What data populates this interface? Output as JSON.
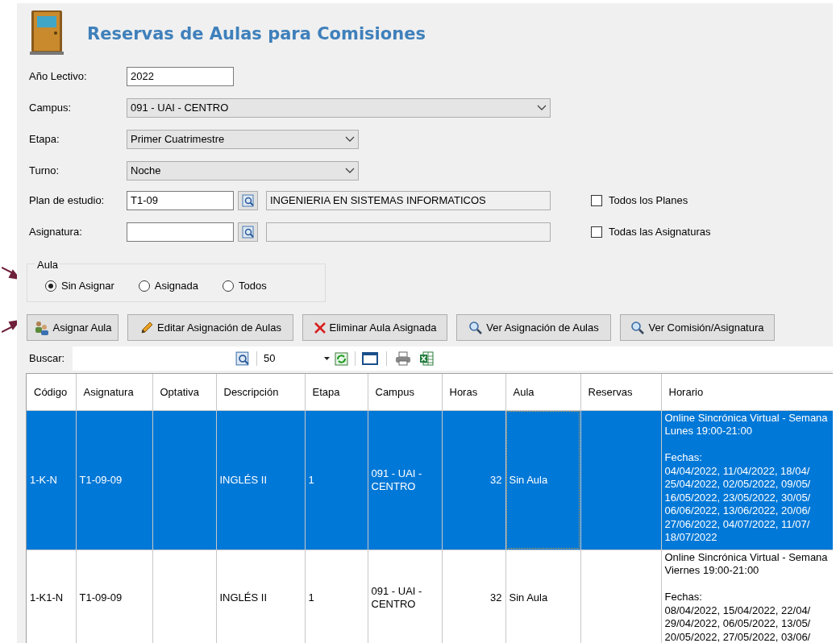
{
  "header": {
    "title": "Reservas de Aulas para Comisiones"
  },
  "form": {
    "fields": [
      {
        "kind": "text",
        "label": "Año Lectivo:",
        "value": "2022"
      },
      {
        "kind": "select",
        "label": "Campus:",
        "value": "091 - UAI - CENTRO"
      },
      {
        "kind": "select",
        "label": "Etapa:",
        "value": "Primer Cuatrimestre"
      },
      {
        "kind": "select",
        "label": "Turno:",
        "value": "Noche"
      },
      {
        "kind": "lookup",
        "label": "Plan de estudio:",
        "value": "T1-09",
        "description": "INGENIERIA EN SISTEMAS INFORMATICOS",
        "checkbox": {
          "label": "Todos los Planes",
          "checked": false
        }
      },
      {
        "kind": "lookup",
        "label": "Asignatura:",
        "checkbox": {
          "label": "Todas las Asignaturas",
          "checked": false
        }
      }
    ]
  },
  "aula_filter": {
    "title": "Aula",
    "options": [
      {
        "label": "Sin Asignar",
        "selected": true
      },
      {
        "label": "Asignada",
        "selected": false
      },
      {
        "label": "Todos",
        "selected": false
      }
    ]
  },
  "actions": [
    {
      "kind": "assign",
      "label": "Asignar Aula"
    },
    {
      "kind": "edit",
      "label": "Editar Asignación de Aulas"
    },
    {
      "kind": "delete",
      "label": "Eliminar Aula Asignada"
    },
    {
      "kind": "view",
      "label": "Ver Asignación de Aulas"
    },
    {
      "kind": "view",
      "label": "Ver Comisión/Asignatura"
    }
  ],
  "toolbar": {
    "search_label": "Buscar:",
    "page_size": "50"
  },
  "table": {
    "columns": [
      "Código",
      "Asignatura",
      "Optativa",
      "Descripción",
      "Etapa",
      "Campus",
      "Horas",
      "Aula",
      "Reservas",
      "Horario"
    ],
    "rows": [
      {
        "selected": true,
        "cells": [
          "1-K-N",
          "T1-09-09",
          "",
          "INGLÉS II",
          "1",
          "091 - UAI - CENTRO",
          "32",
          "Sin Aula",
          ""
        ],
        "horario": [
          [
            "Online Sincrónica Virtual - Semana",
            "Lunes 19:00-21:00"
          ],
          [
            "Fechas:",
            "04/04/2022, 11/04/2022, 18/04/",
            "25/04/2022, 02/05/2022, 09/05/",
            "16/05/2022, 23/05/2022, 30/05/",
            "06/06/2022, 13/06/2022, 20/06/",
            "27/06/2022, 04/07/2022, 11/07/",
            "18/07/2022"
          ]
        ]
      },
      {
        "selected": false,
        "cells": [
          "1-K1-N",
          "T1-09-09",
          "",
          "INGLÉS II",
          "1",
          "091 - UAI - CENTRO",
          "32",
          "Sin Aula",
          ""
        ],
        "horario": [
          [
            "Online Sincrónica Virtual - Semana",
            "Viernes 19:00-21:00"
          ],
          [
            "Fechas:",
            "08/04/2022, 15/04/2022, 22/04/",
            "29/04/2022, 06/05/2022, 13/05/",
            "20/05/2022, 27/05/2022, 03/06/"
          ]
        ]
      }
    ]
  }
}
